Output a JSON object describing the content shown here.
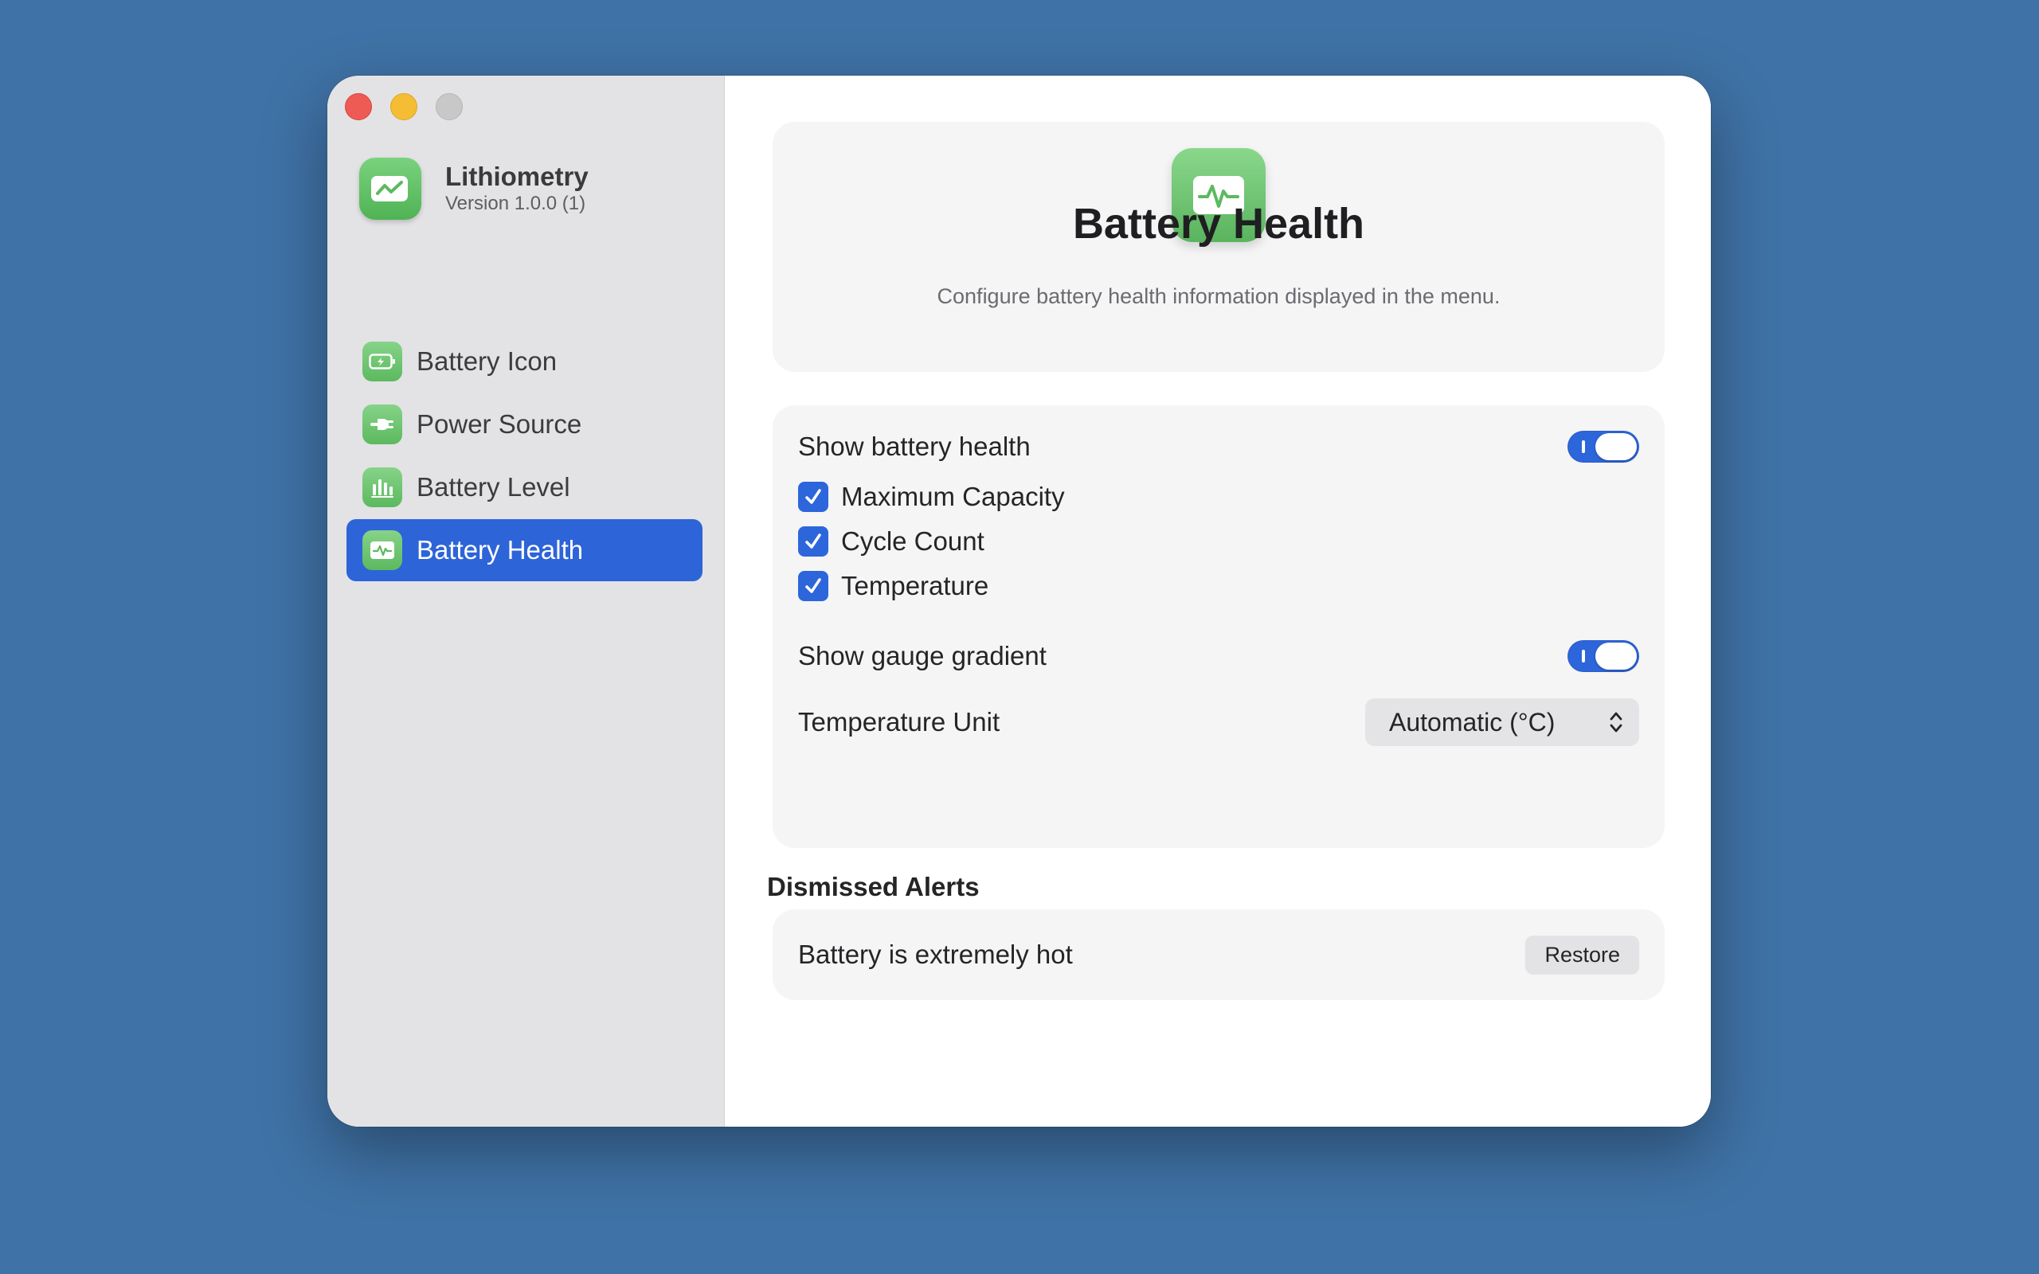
{
  "app": {
    "name": "Lithiometry",
    "version": "Version 1.0.0 (1)"
  },
  "sidebar": {
    "items": [
      {
        "label": "Battery Icon",
        "icon": "battery-icon",
        "selected": false
      },
      {
        "label": "Power Source",
        "icon": "plug-icon",
        "selected": false
      },
      {
        "label": "Battery Level",
        "icon": "bar-chart-icon",
        "selected": false
      },
      {
        "label": "Battery Health",
        "icon": "pulse-icon",
        "selected": true
      }
    ]
  },
  "header": {
    "title": "Battery Health",
    "subtitle": "Configure battery health information displayed in the menu."
  },
  "settings": {
    "show_health_label": "Show battery health",
    "show_health_on": true,
    "checks": [
      {
        "label": "Maximum Capacity",
        "checked": true
      },
      {
        "label": "Cycle Count",
        "checked": true
      },
      {
        "label": "Temperature",
        "checked": true
      }
    ],
    "gauge_label": "Show gauge gradient",
    "gauge_on": true,
    "temp_unit_label": "Temperature Unit",
    "temp_unit_value": "Automatic (°C)"
  },
  "dismissed": {
    "title": "Dismissed Alerts",
    "alert_label": "Battery is extremely hot",
    "restore_label": "Restore"
  },
  "colors": {
    "accent": "#2d64d8",
    "icon_green": "#5cb95f",
    "desktop": "#3f72a6"
  }
}
